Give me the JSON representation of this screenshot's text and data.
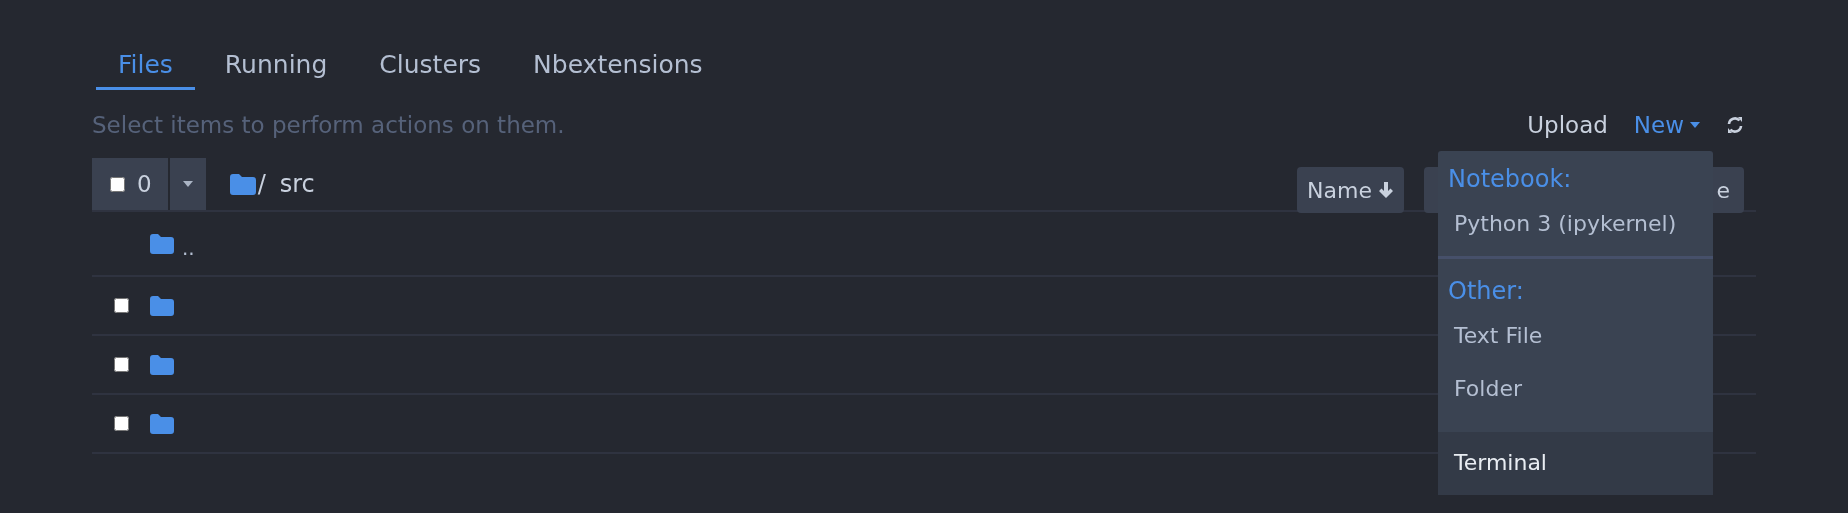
{
  "tabs": [
    {
      "label": "Files",
      "selected": true
    },
    {
      "label": "Running",
      "selected": false
    },
    {
      "label": "Clusters",
      "selected": false
    },
    {
      "label": "Nbextensions",
      "selected": false
    }
  ],
  "hint": "Select items to perform actions on them.",
  "actions": {
    "upload": "Upload",
    "new": "New"
  },
  "toolbar": {
    "select_all": {
      "checked": false,
      "count": "0"
    },
    "breadcrumb": {
      "separator": "/",
      "folder": "src"
    }
  },
  "sort_buttons": [
    {
      "label": "Name",
      "kind": "sort"
    },
    {
      "label": "e",
      "kind": "covered"
    }
  ],
  "rows": [
    {
      "kind": "parent",
      "name": ".."
    },
    {
      "kind": "folder",
      "checked": false
    },
    {
      "kind": "folder",
      "checked": false
    },
    {
      "kind": "folder",
      "checked": false
    }
  ],
  "new_menu": [
    {
      "kind": "header",
      "label": "Notebook:"
    },
    {
      "kind": "item",
      "label": "Python 3 (ipykernel)",
      "selected": false
    },
    {
      "kind": "divider"
    },
    {
      "kind": "header",
      "label": "Other:"
    },
    {
      "kind": "item",
      "label": "Text File",
      "selected": false
    },
    {
      "kind": "item",
      "label": "Folder",
      "selected": false
    },
    {
      "kind": "item",
      "label": "Terminal",
      "selected": true
    }
  ]
}
